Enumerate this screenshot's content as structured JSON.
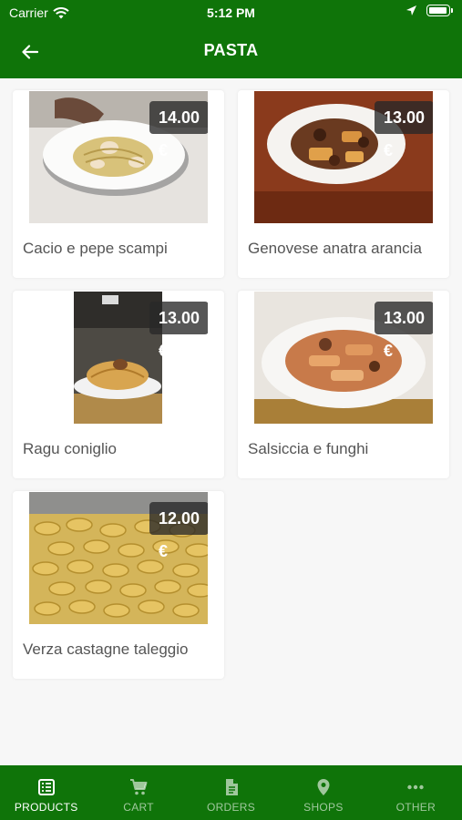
{
  "status_bar": {
    "carrier": "Carrier",
    "time": "5:12 PM"
  },
  "header": {
    "title": "PASTA",
    "back_icon": "arrow-left-icon"
  },
  "products": [
    {
      "name": "Cacio e pepe scampi",
      "price": "14.00 €"
    },
    {
      "name": "Genovese anatra arancia",
      "price": "13.00 €"
    },
    {
      "name": "Ragu coniglio",
      "price": "13.00 €"
    },
    {
      "name": "Salsiccia e funghi",
      "price": "13.00 €"
    },
    {
      "name": "Verza castagne taleggio",
      "price": "12.00 €"
    }
  ],
  "tabbar": {
    "items": [
      {
        "label": "PRODUCTS",
        "icon": "list-icon",
        "active": true
      },
      {
        "label": "CART",
        "icon": "cart-icon",
        "active": false
      },
      {
        "label": "ORDERS",
        "icon": "document-icon",
        "active": false
      },
      {
        "label": "SHOPS",
        "icon": "location-pin-icon",
        "active": false
      },
      {
        "label": "OTHER",
        "icon": "more-icon",
        "active": false
      }
    ]
  },
  "colors": {
    "brand": "#0f7409",
    "price_badge": "#282828"
  }
}
